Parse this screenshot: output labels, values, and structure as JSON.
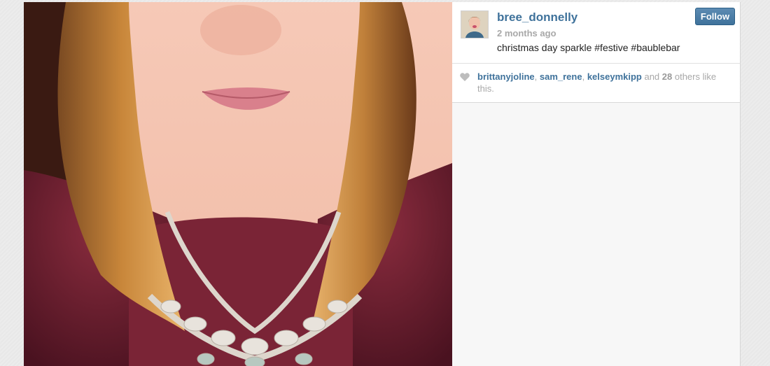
{
  "post": {
    "username": "bree_donnelly",
    "time_ago": "2 months ago",
    "caption": "christmas day sparkle #festive #baublebar",
    "follow_label": "Follow"
  },
  "likes": {
    "users": [
      "brittanyjoline",
      "sam_rene",
      "kelseymkipp"
    ],
    "sep1": ", ",
    "sep2": ", ",
    "and_text": " and ",
    "others_count": "28",
    "suffix": " others like this."
  },
  "icons": {
    "like": "heart-icon"
  },
  "colors": {
    "link": "#3f729b",
    "follow_button": "#3f729b",
    "muted": "#a8a8a8",
    "sweater": "#6e1f30",
    "hair": "#c8863a"
  }
}
